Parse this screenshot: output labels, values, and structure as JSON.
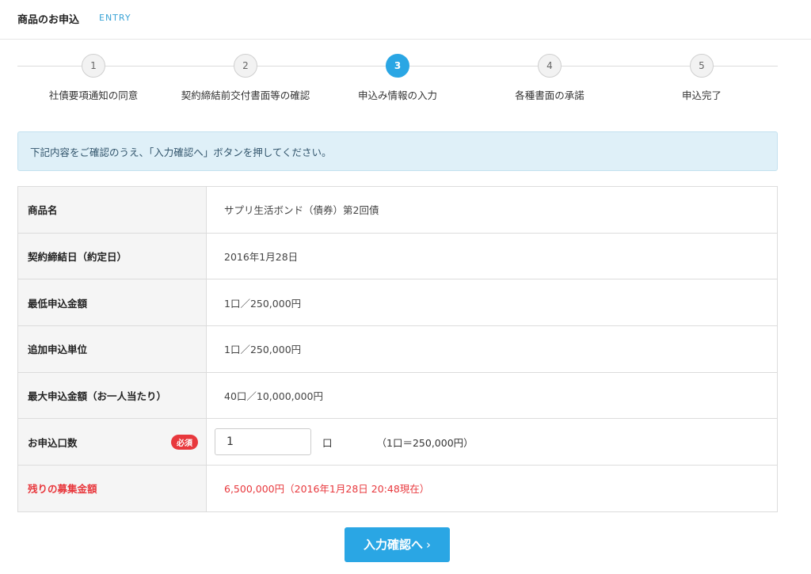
{
  "header": {
    "title": "商品のお申込",
    "subtitle": "ENTRY"
  },
  "steps": [
    {
      "number": "1",
      "label": "社債要項通知の同意"
    },
    {
      "number": "2",
      "label": "契約締結前交付書面等の確認"
    },
    {
      "number": "3",
      "label": "申込み情報の入力"
    },
    {
      "number": "4",
      "label": "各種書面の承諾"
    },
    {
      "number": "5",
      "label": "申込完了"
    }
  ],
  "active_step": 3,
  "notice": "下記内容をご確認のうえ、「入力確認へ」ボタンを押してください。",
  "table": {
    "product_name": {
      "label": "商品名",
      "value": "サプリ生活ボンド（債券）第2回債"
    },
    "contract_date": {
      "label": "契約締結日（約定日）",
      "value": "2016年1月28日"
    },
    "min_amount": {
      "label": "最低申込金額",
      "value": "1口／250,000円"
    },
    "additional_unit": {
      "label": "追加申込単位",
      "value": "1口／250,000円"
    },
    "max_amount": {
      "label": "最大申込金額（お一人当たり）",
      "value": "40口／10,000,000円"
    },
    "quantity": {
      "label": "お申込口数",
      "badge": "必須",
      "value": "1",
      "unit": "口",
      "note": "（1口＝250,000円）"
    },
    "remaining": {
      "label": "残りの募集金額",
      "value": "6,500,000円（2016年1月28日 20:48現在）"
    }
  },
  "submit": {
    "label": "入力確認へ",
    "chevron": "›"
  },
  "colors": {
    "accent": "#2aa6e4",
    "warning": "#e8383d",
    "notice_bg": "#dff0f8"
  }
}
